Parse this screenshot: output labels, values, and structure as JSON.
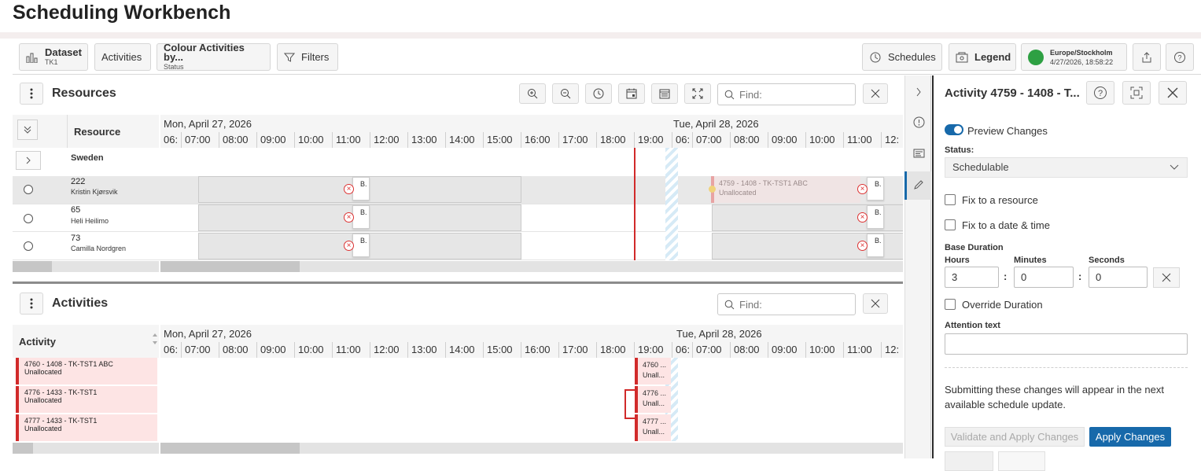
{
  "page": {
    "title": "Scheduling Workbench"
  },
  "toolbar": {
    "dataset_label": "Dataset",
    "dataset_value": "TK1",
    "activities_label": "Activities",
    "colour_label": "Colour Activities by...",
    "colour_value": "Status",
    "filters_label": "Filters",
    "schedules_label": "Schedules",
    "legend_label": "Legend",
    "timezone": "Europe/Stockholm",
    "datetime": "4/27/2026, 18:58:22",
    "status_color": "#2ea043"
  },
  "resources": {
    "title": "Resources",
    "find_placeholder": "Find:",
    "column_header": "Resource",
    "group": "Sweden",
    "rows": [
      {
        "id": "222",
        "name": "Kristin Kjørsvik"
      },
      {
        "id": "65",
        "name": "Heli Heilimo"
      },
      {
        "id": "73",
        "name": "Camilla Nordgren"
      }
    ],
    "chip_label": "B.",
    "ghost_activity": {
      "line1": "4759 - 1408 - TK-TST1 ABC",
      "line2": "Unallocated"
    }
  },
  "timeline": {
    "day1": "Mon, April 27, 2026",
    "day2": "Tue, April 28, 2026",
    "hours_day1": [
      "06:",
      "07:00",
      "08:00",
      "09:00",
      "10:00",
      "11:00",
      "12:00",
      "13:00",
      "14:00",
      "15:00",
      "16:00",
      "17:00",
      "18:00",
      "19:00"
    ],
    "hours_day2": [
      "06:",
      "07:00",
      "08:00",
      "09:00",
      "10:00",
      "11:00",
      "12:"
    ]
  },
  "activities": {
    "title": "Activities",
    "find_placeholder": "Find:",
    "column_header": "Activity",
    "rows": [
      {
        "line1": "4760 - 1408 - TK-TST1 ABC",
        "line2": "Unallocated",
        "mini1": "4760 ...",
        "mini2": "Unall..."
      },
      {
        "line1": "4776 - 1433 - TK-TST1",
        "line2": "Unallocated",
        "mini1": "4776 ...",
        "mini2": "Unall..."
      },
      {
        "line1": "4777 - 1433 - TK-TST1",
        "line2": "Unallocated",
        "mini1": "4777 ...",
        "mini2": "Unall..."
      }
    ]
  },
  "details": {
    "title": "Activity 4759 - 1408 - T...",
    "preview_label": "Preview Changes",
    "status_label": "Status:",
    "status_value": "Schedulable",
    "fix_resource_label": "Fix to a resource",
    "fix_datetime_label": "Fix to a date & time",
    "base_duration_label": "Base Duration",
    "hours_label": "Hours",
    "minutes_label": "Minutes",
    "seconds_label": "Seconds",
    "hours_value": "3",
    "minutes_value": "0",
    "seconds_value": "0",
    "override_label": "Override Duration",
    "attention_label": "Attention text",
    "attention_value": "",
    "info_text": "Submitting these changes will appear in the next available schedule update.",
    "validate_apply_label": "Validate and Apply Changes",
    "apply_label": "Apply Changes"
  },
  "colors": {
    "accent": "#1769aa",
    "now_line": "#d12a2a",
    "unallocated_bg": "#fde4e4"
  }
}
